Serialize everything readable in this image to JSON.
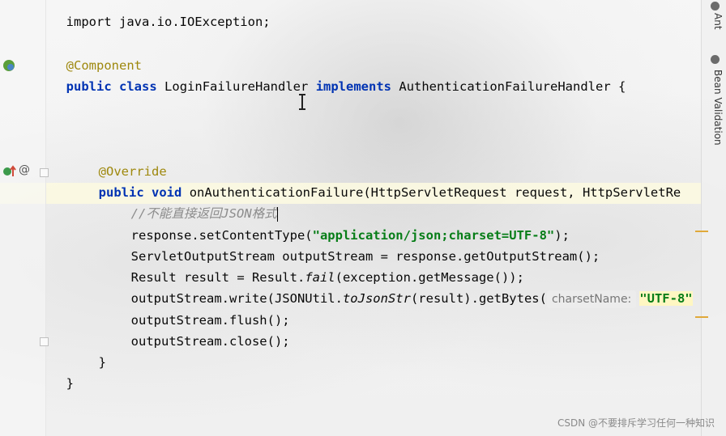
{
  "right_panel": {
    "tabs": [
      "Ant",
      "Bean Validation"
    ]
  },
  "code": {
    "line_import": "import java.io.IOException;",
    "annotation_component": "@Component",
    "class_kw1": "public",
    "class_kw2": "class",
    "class_name": "LoginFailureHandler",
    "class_kw3": "implements",
    "class_iface": "AuthenticationFailureHandler {",
    "annotation_override": "@Override",
    "method_kw1": "public",
    "method_kw2": "void",
    "method_sig": "onAuthenticationFailure(HttpServletRequest request, HttpServletRe",
    "comment": "//不能直接返回JSON格式",
    "l1_a": "response.setContentType(",
    "l1_str": "\"application/json;charset=UTF-8\"",
    "l1_b": ");",
    "l2": "ServletOutputStream outputStream = response.getOutputStream();",
    "l3_a": "Result result = Result.",
    "l3_fail": "fail",
    "l3_b": "(exception.getMessage());",
    "l4_a": "outputStream.write(JSONUtil.",
    "l4_method": "toJsonStr",
    "l4_b": "(result).getBytes(",
    "l4_hint": "charsetName:",
    "l4_str": "\"UTF-8\"",
    "l5": "outputStream.flush();",
    "l6": "outputStream.close();",
    "close_method": "}",
    "close_class": "}"
  },
  "gutter": {
    "override_marker": "@"
  },
  "watermark": "CSDN @不要排斥学习任何一种知识"
}
